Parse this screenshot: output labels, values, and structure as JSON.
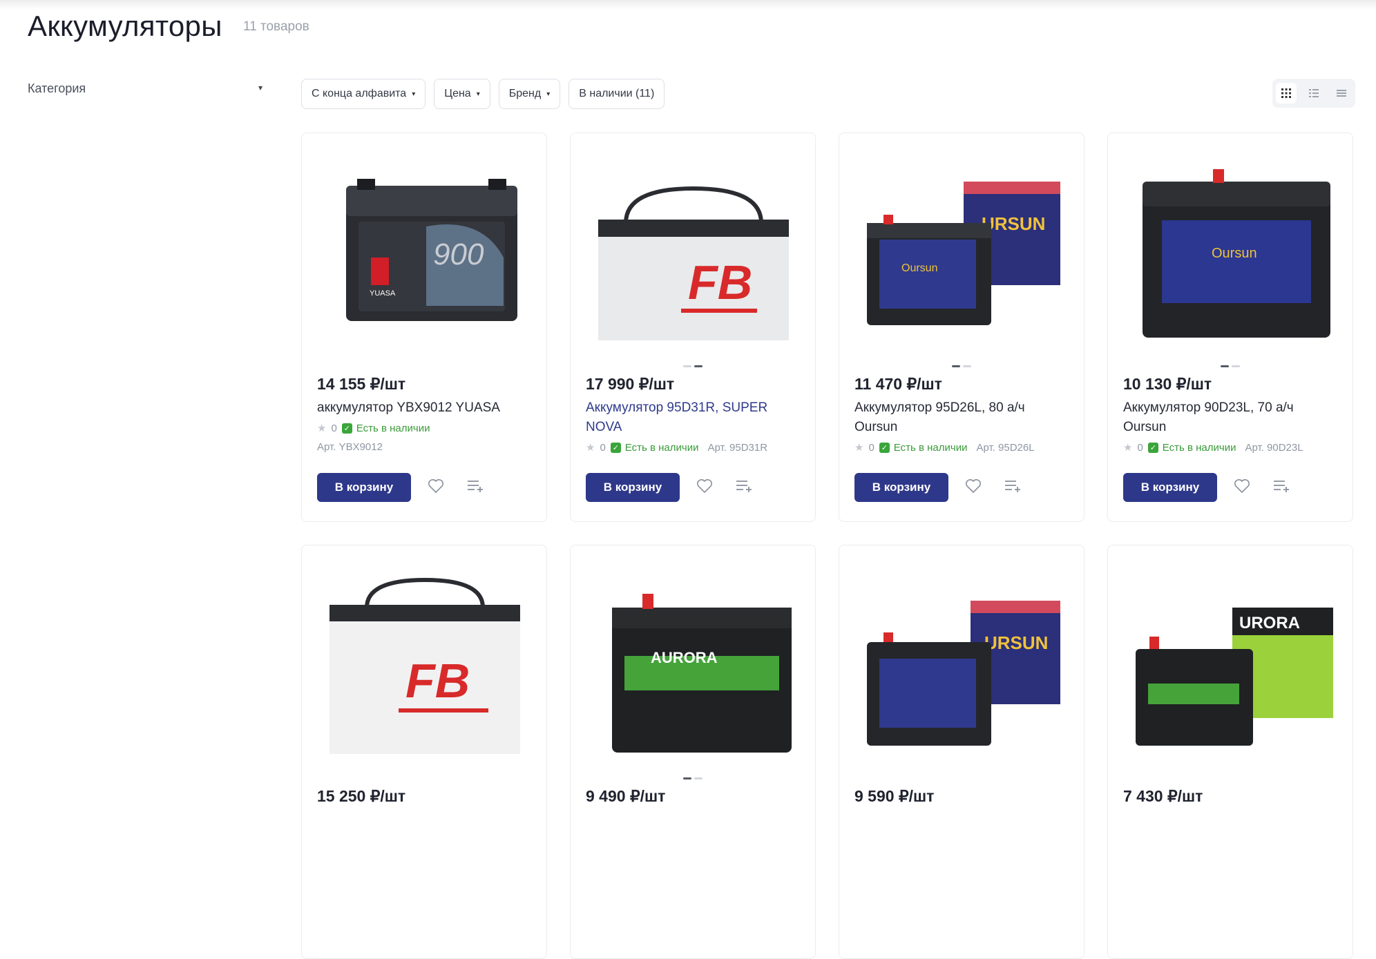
{
  "page": {
    "title": "Аккумуляторы",
    "count": "11 товаров"
  },
  "sidebar": {
    "category_label": "Категория"
  },
  "filters": [
    {
      "label": "С конца алфавита",
      "dropdown": true
    },
    {
      "label": "Цена",
      "dropdown": true
    },
    {
      "label": "Бренд",
      "dropdown": true
    },
    {
      "label": "В наличии (11)",
      "dropdown": false
    }
  ],
  "view_modes": [
    "grid-view-icon",
    "list-view-icon",
    "compact-list-view-icon"
  ],
  "colors": {
    "accent": "#2e388a",
    "stock": "#3a9a3a"
  },
  "products": [
    {
      "price": "14 155 ₽/шт",
      "name": "аккумулятор YBX9012 YUASA",
      "rating": "0",
      "stock": "Есть в наличии",
      "sku": "Арт. YBX9012",
      "button": "В корзину",
      "image": "battery-yuasa"
    },
    {
      "price": "17 990 ₽/шт",
      "name": "Аккумулятор 95D31R, SUPER NOVA",
      "rating": "0",
      "stock": "Есть в наличии",
      "sku": "Арт. 95D31R",
      "button": "В корзину",
      "image": "battery-fb"
    },
    {
      "price": "11 470 ₽/шт",
      "name": "Аккумулятор 95D26L, 80 а/ч Oursun",
      "rating": "0",
      "stock": "Есть в наличии",
      "sku": "Арт. 95D26L",
      "button": "В корзину",
      "image": "battery-oursun"
    },
    {
      "price": "10 130 ₽/шт",
      "name": "Аккумулятор 90D23L, 70 а/ч Oursun",
      "rating": "0",
      "stock": "Есть в наличии",
      "sku": "Арт. 90D23L",
      "button": "В корзину",
      "image": "battery-oursun-2"
    },
    {
      "price": "15 250 ₽/шт",
      "image": "battery-fb-2"
    },
    {
      "price": "9 490 ₽/шт",
      "image": "battery-aurora"
    },
    {
      "price": "9 590 ₽/шт",
      "image": "battery-oursun-3"
    },
    {
      "price": "7 430 ₽/шт",
      "image": "battery-aurora-2"
    }
  ]
}
